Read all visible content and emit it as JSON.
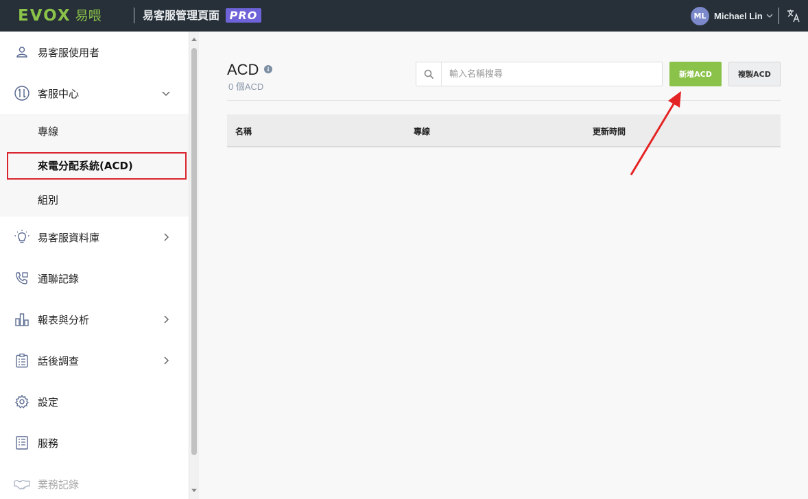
{
  "header": {
    "logo_text": "EVOX",
    "logo_cn": "易喂",
    "app_title": "易客服管理頁面",
    "pro_badge": "PRO",
    "user_initials": "ML",
    "user_name": "Michael Lin",
    "language_icon": "translate-icon"
  },
  "sidebar": {
    "items": [
      {
        "label": "易客服使用者",
        "icon": "user-icon"
      },
      {
        "label": "客服中心",
        "icon": "call-center-icon",
        "expanded": true
      },
      {
        "label": "易客服資料庫",
        "icon": "lightbulb-icon"
      },
      {
        "label": "通聯記錄",
        "icon": "phone-log-icon"
      },
      {
        "label": "報表與分析",
        "icon": "bar-chart-icon"
      },
      {
        "label": "話後調查",
        "icon": "clipboard-icon"
      },
      {
        "label": "設定",
        "icon": "gear-icon"
      },
      {
        "label": "服務",
        "icon": "document-icon"
      },
      {
        "label": "業務記錄",
        "icon": "handshake-icon"
      }
    ],
    "sub_items": [
      {
        "label": "專線"
      },
      {
        "label": "來電分配系統(ACD)",
        "active": true
      },
      {
        "label": "組別"
      }
    ]
  },
  "main": {
    "title": "ACD",
    "info_icon": "i",
    "count_text": "0 個ACD",
    "search": {
      "placeholder": "輸入名稱搜尋",
      "value": ""
    },
    "add_button": "新增ACD",
    "copy_button": "複製ACD",
    "table": {
      "columns": [
        "名稱",
        "專線",
        "更新時間"
      ],
      "rows": []
    }
  },
  "colors": {
    "header_bg": "#273038",
    "brand_green": "#8bc34a",
    "pro_purple": "#6f63d9",
    "highlight_red": "#d9232d"
  }
}
